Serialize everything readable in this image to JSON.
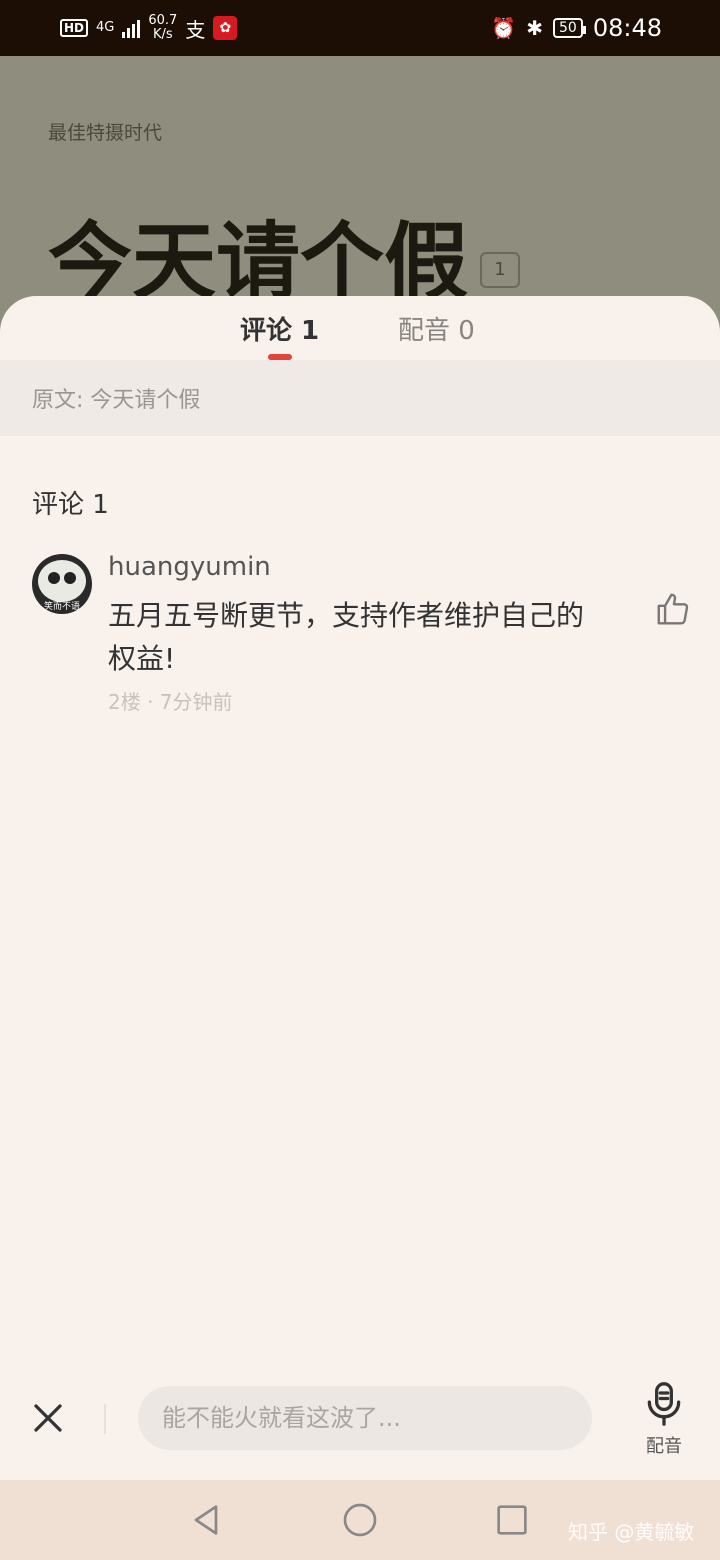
{
  "status_bar": {
    "hd": "HD",
    "network": "4G",
    "speed_value": "60.7",
    "speed_unit": "K/s",
    "pay_icon_text": "支",
    "battery": "50",
    "time": "08:48"
  },
  "background_page": {
    "subtitle": "最佳特摄时代",
    "title": "今天请个假",
    "comment_count": "1"
  },
  "sheet": {
    "tabs": [
      {
        "label": "评论 1"
      },
      {
        "label": "配音 0"
      }
    ],
    "source_text": "原文: 今天请个假",
    "comments_header": "评论 1",
    "comments": [
      {
        "username": "huangyumin",
        "avatar_caption": "笑而不语",
        "text": "五月五号断更节，支持作者维护自己的权益!",
        "meta": "2楼 · 7分钟前"
      }
    ]
  },
  "bottom_bar": {
    "input_placeholder": "能不能火就看这波了...",
    "dub_label": "配音"
  },
  "nav": {
    "watermark": "知乎 @黄毓敏"
  },
  "colors": {
    "accent": "#e0443b",
    "sheet_bg": "#f8f1ec",
    "overlay": "#8f8e7e"
  }
}
